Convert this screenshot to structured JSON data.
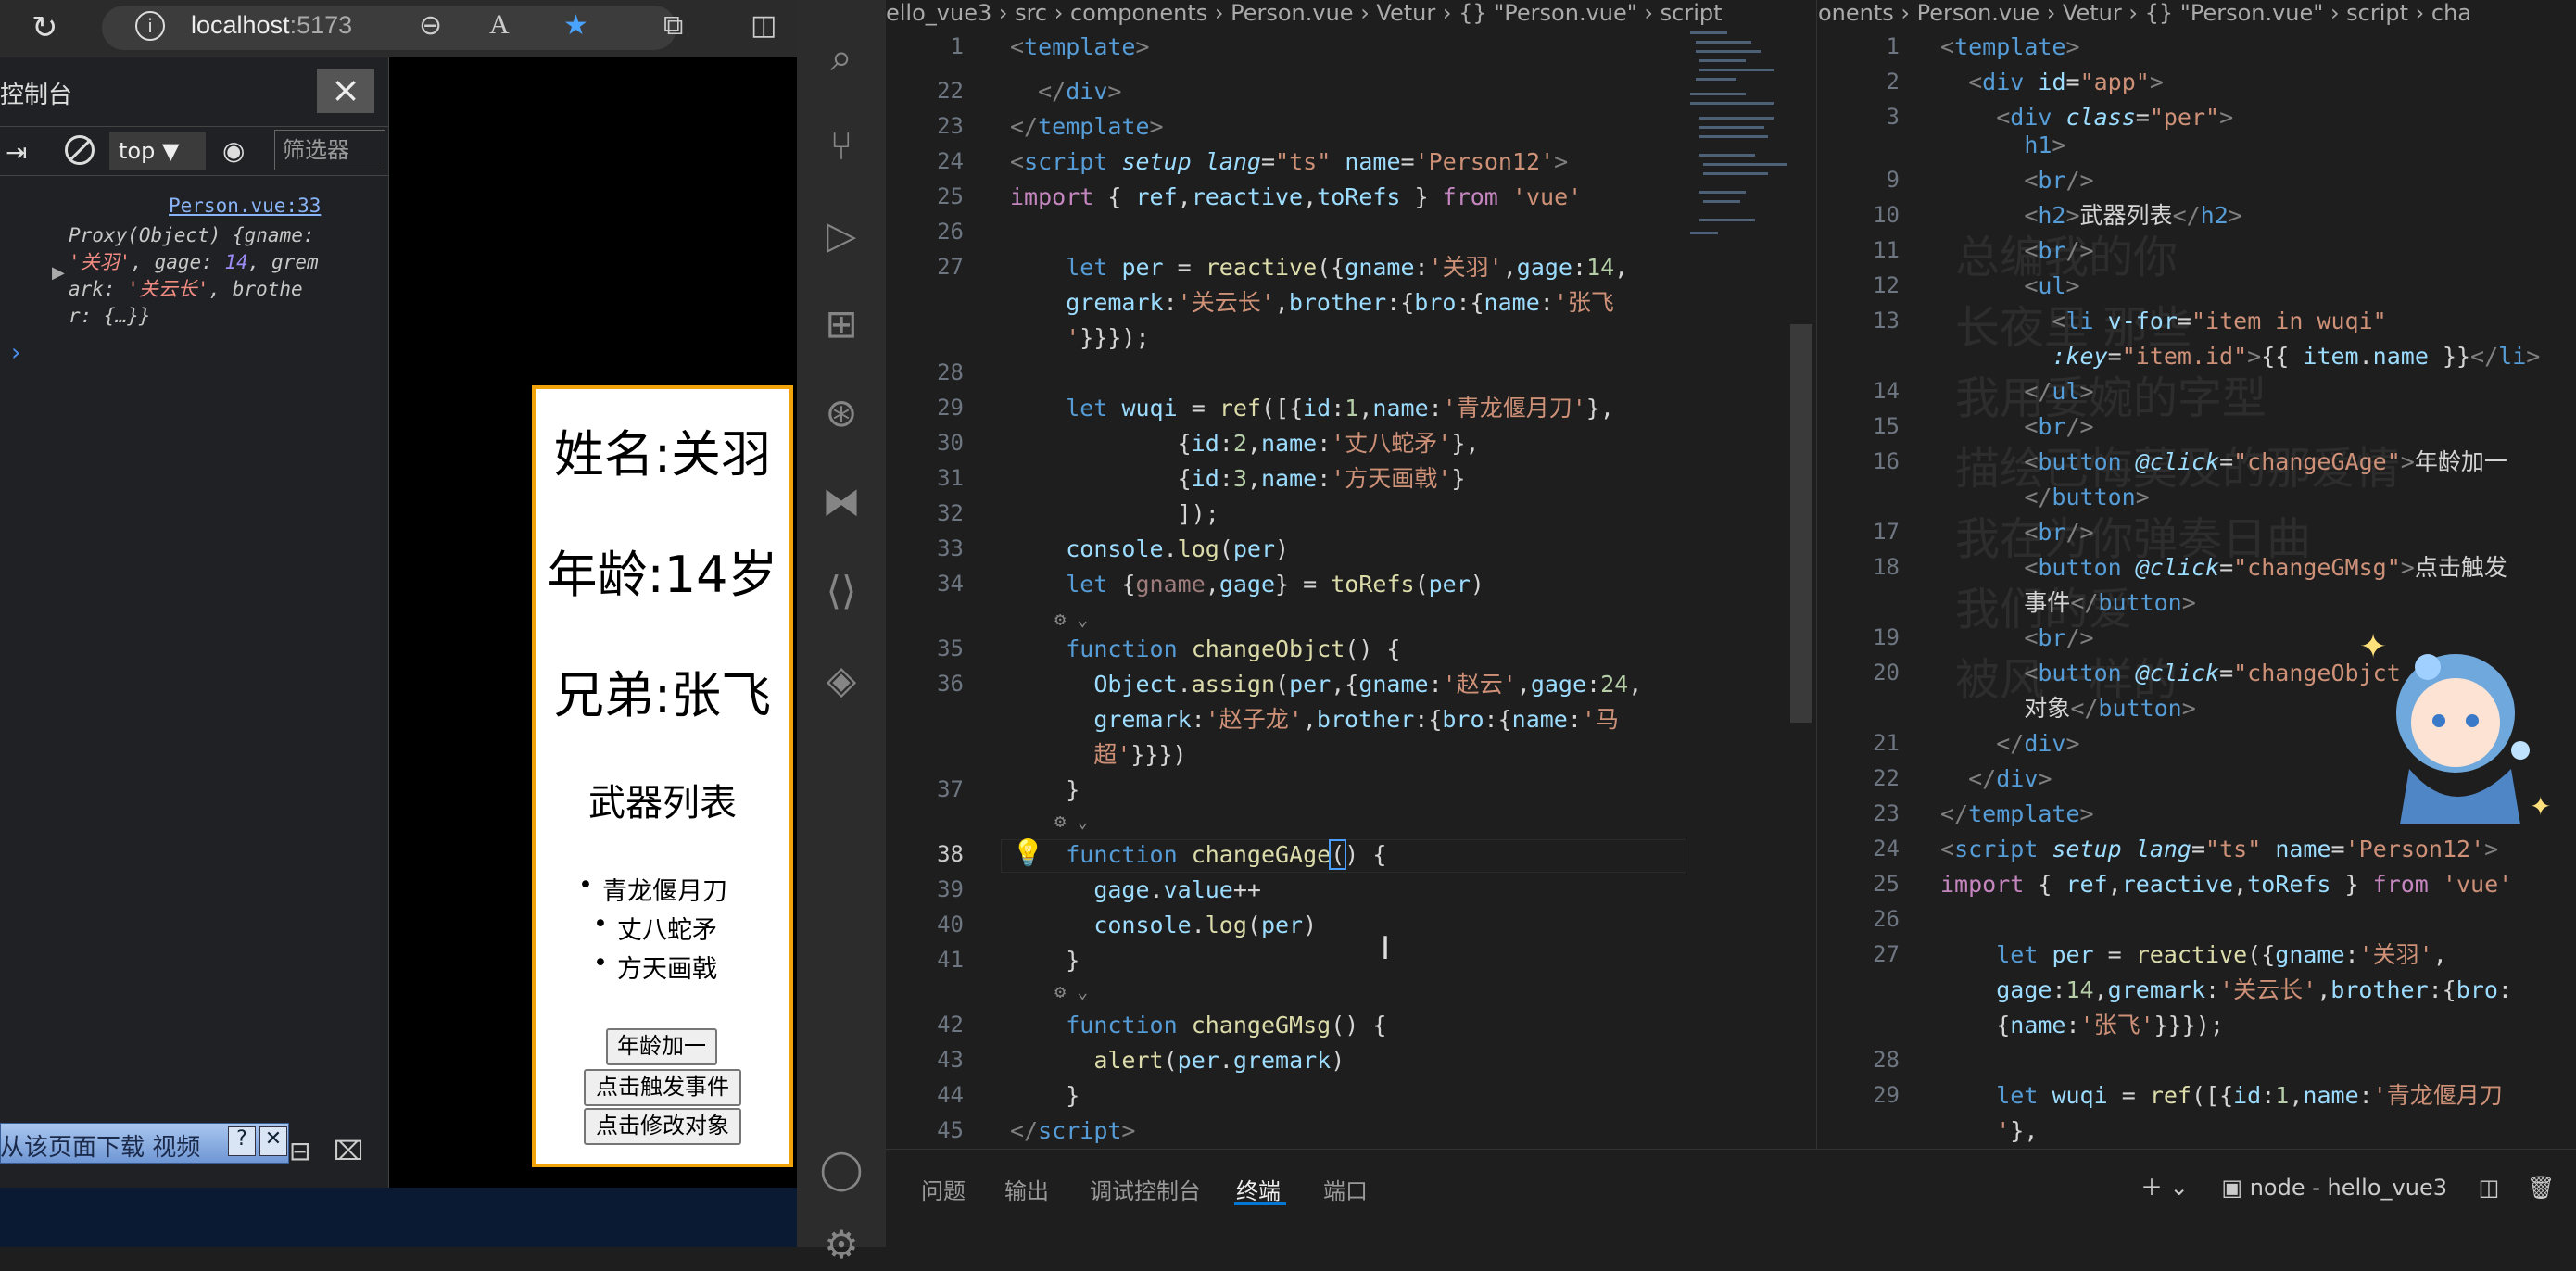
{
  "browser": {
    "host": "localhost",
    "port": ":5173"
  },
  "devtools": {
    "title": "控制台",
    "context": "top",
    "filter_placeholder": "筛选器",
    "log_source": "Person.vue:33"
  },
  "downloader": {
    "text": "从该页面下载 视频",
    "help": "?",
    "close": "✕"
  },
  "app": {
    "name": "姓名:关羽",
    "age": "年龄:14岁",
    "brother": "兄弟:张飞",
    "weapons_title": "武器列表",
    "weapons": [
      "青龙偃月刀",
      "丈八蛇矛",
      "方天画戟"
    ],
    "btn_age": "年龄加一",
    "btn_msg": "点击触发事件",
    "btn_obj": "点击修改对象"
  },
  "editor_left": {
    "breadcrumb": "ello_vue3 › src › components › Person.vue › Vetur › {} \"Person.vue\" › script"
  },
  "editor_right": {
    "breadcrumb": "onents › Person.vue › Vetur › {} \"Person.vue\" › script › cha"
  },
  "panel": {
    "tabs": [
      "问题",
      "输出",
      "调试控制台",
      "终端",
      "端口"
    ],
    "terminal_name": "node - hello_vue3"
  },
  "colors": {
    "accent": "#0078d4",
    "card_border": "#f0a30a"
  }
}
